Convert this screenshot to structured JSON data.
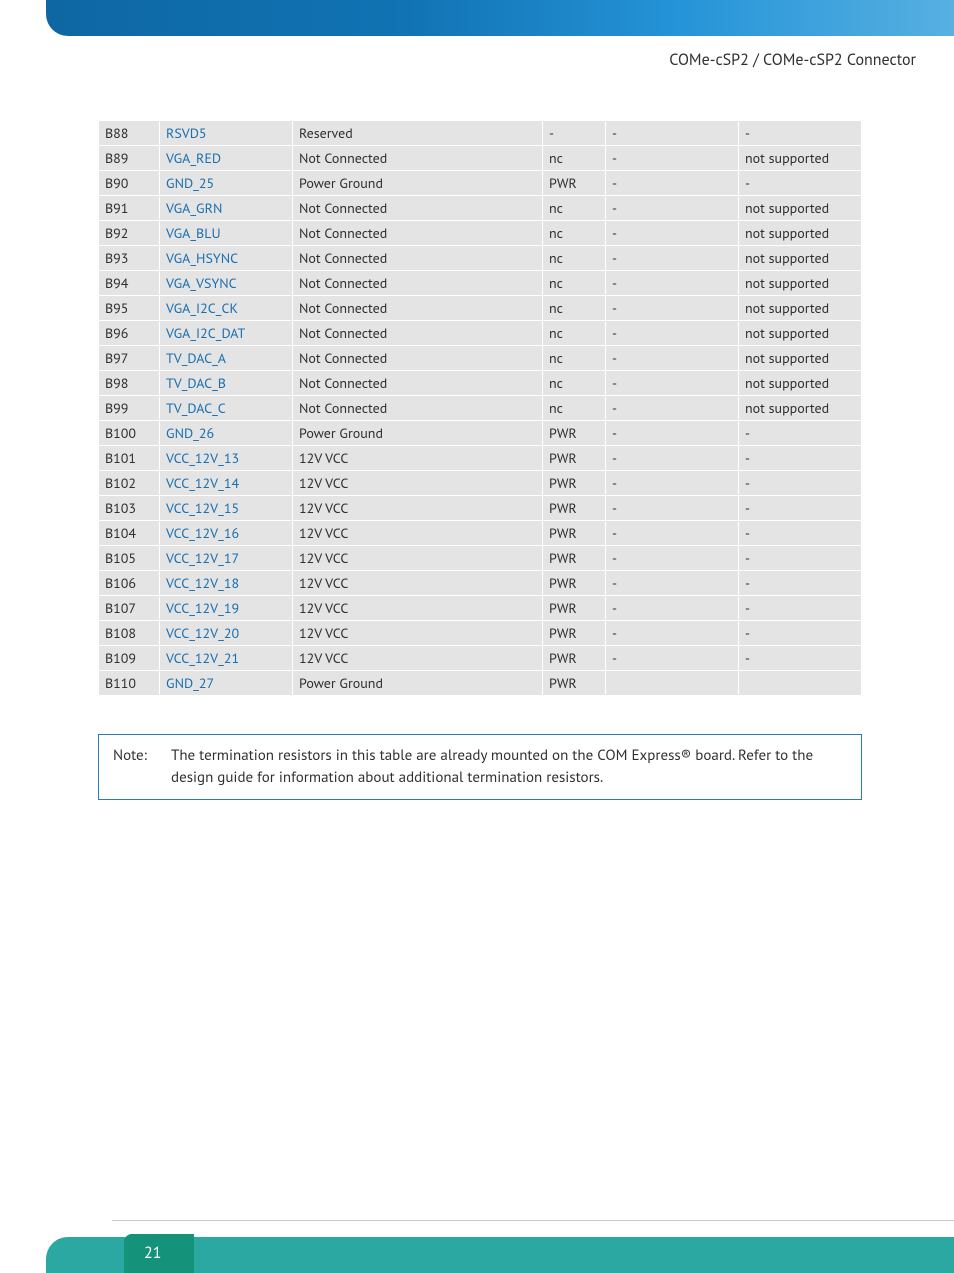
{
  "header": {
    "title": "COMe-cSP2 / COMe-cSP2 Connector"
  },
  "table": {
    "rows": [
      {
        "pin": "B88",
        "signal": "RSVD5",
        "desc": "Reserved",
        "col4": "-",
        "col5": "-",
        "col6": "-"
      },
      {
        "pin": "B89",
        "signal": "VGA_RED",
        "desc": "Not Connected",
        "col4": "nc",
        "col5": "-",
        "col6": "not supported"
      },
      {
        "pin": "B90",
        "signal": "GND_25",
        "desc": "Power Ground",
        "col4": "PWR",
        "col5": "-",
        "col6": "-"
      },
      {
        "pin": "B91",
        "signal": "VGA_GRN",
        "desc": "Not Connected",
        "col4": "nc",
        "col5": "-",
        "col6": "not supported"
      },
      {
        "pin": "B92",
        "signal": "VGA_BLU",
        "desc": "Not Connected",
        "col4": "nc",
        "col5": "-",
        "col6": "not supported"
      },
      {
        "pin": "B93",
        "signal": "VGA_HSYNC",
        "desc": "Not Connected",
        "col4": "nc",
        "col5": "-",
        "col6": "not supported"
      },
      {
        "pin": "B94",
        "signal": "VGA_VSYNC",
        "desc": "Not Connected",
        "col4": "nc",
        "col5": "-",
        "col6": "not supported"
      },
      {
        "pin": "B95",
        "signal": "VGA_I2C_CK",
        "desc": "Not Connected",
        "col4": "nc",
        "col5": "-",
        "col6": "not supported"
      },
      {
        "pin": "B96",
        "signal": "VGA_I2C_DAT",
        "desc": "Not Connected",
        "col4": "nc",
        "col5": "-",
        "col6": "not supported"
      },
      {
        "pin": "B97",
        "signal": "TV_DAC_A",
        "desc": "Not Connected",
        "col4": "nc",
        "col5": "-",
        "col6": "not supported"
      },
      {
        "pin": "B98",
        "signal": "TV_DAC_B",
        "desc": "Not Connected",
        "col4": "nc",
        "col5": "-",
        "col6": "not supported"
      },
      {
        "pin": "B99",
        "signal": "TV_DAC_C",
        "desc": "Not Connected",
        "col4": "nc",
        "col5": "-",
        "col6": "not supported"
      },
      {
        "pin": "B100",
        "signal": "GND_26",
        "desc": "Power Ground",
        "col4": "PWR",
        "col5": "-",
        "col6": "-"
      },
      {
        "pin": "B101",
        "signal": "VCC_12V_13",
        "desc": "12V VCC",
        "col4": "PWR",
        "col5": "-",
        "col6": "-"
      },
      {
        "pin": "B102",
        "signal": "VCC_12V_14",
        "desc": "12V VCC",
        "col4": "PWR",
        "col5": "-",
        "col6": "-"
      },
      {
        "pin": "B103",
        "signal": "VCC_12V_15",
        "desc": "12V VCC",
        "col4": "PWR",
        "col5": "-",
        "col6": "-"
      },
      {
        "pin": "B104",
        "signal": "VCC_12V_16",
        "desc": "12V VCC",
        "col4": "PWR",
        "col5": "-",
        "col6": "-"
      },
      {
        "pin": "B105",
        "signal": "VCC_12V_17",
        "desc": "12V VCC",
        "col4": "PWR",
        "col5": "-",
        "col6": "-"
      },
      {
        "pin": "B106",
        "signal": "VCC_12V_18",
        "desc": "12V VCC",
        "col4": "PWR",
        "col5": "-",
        "col6": "-"
      },
      {
        "pin": "B107",
        "signal": "VCC_12V_19",
        "desc": "12V VCC",
        "col4": "PWR",
        "col5": "-",
        "col6": "-"
      },
      {
        "pin": "B108",
        "signal": "VCC_12V_20",
        "desc": "12V VCC",
        "col4": "PWR",
        "col5": "-",
        "col6": "-"
      },
      {
        "pin": "B109",
        "signal": "VCC_12V_21",
        "desc": "12V VCC",
        "col4": "PWR",
        "col5": "-",
        "col6": "-"
      },
      {
        "pin": "B110",
        "signal": "GND_27",
        "desc": "Power Ground",
        "col4": "PWR",
        "col5": "",
        "col6": ""
      }
    ]
  },
  "note": {
    "label": "Note:",
    "text": "The termination resistors in this table are already mounted on the COM Express® board. Refer to the design guide for information about additional termination resistors."
  },
  "footer": {
    "page_number": "21"
  }
}
